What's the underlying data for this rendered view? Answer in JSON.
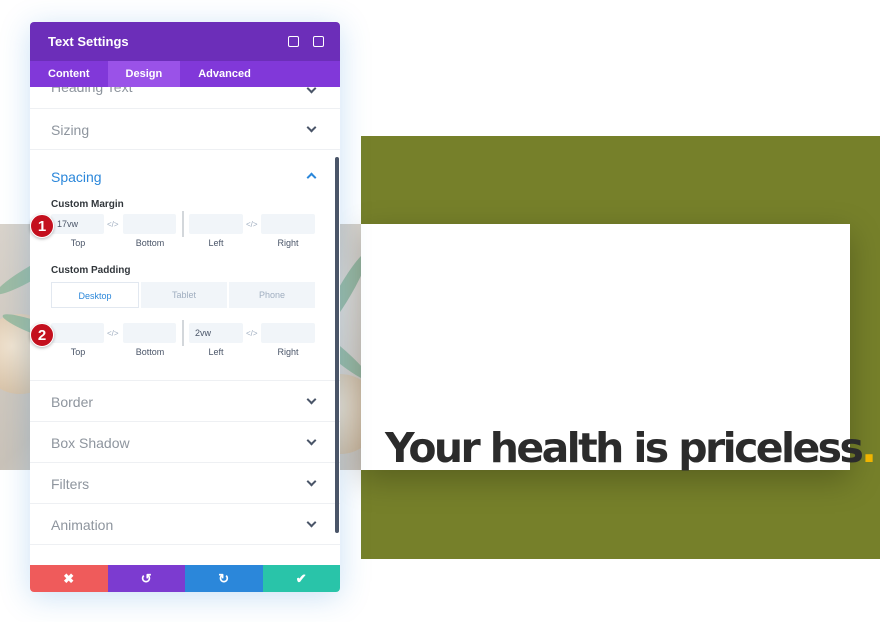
{
  "panel": {
    "title": "Text Settings",
    "tabs": [
      "Content",
      "Design",
      "Advanced"
    ],
    "active_tab": "Design"
  },
  "sections": {
    "heading_text": "Heading Text",
    "sizing": "Sizing",
    "spacing": "Spacing",
    "border": "Border",
    "box_shadow": "Box Shadow",
    "filters": "Filters",
    "animation": "Animation"
  },
  "spacing": {
    "margin_title": "Custom Margin",
    "margin": {
      "top": "17vw",
      "bottom": "",
      "left": "",
      "right": ""
    },
    "padding_title": "Custom Padding",
    "devices": [
      "Desktop",
      "Tablet",
      "Phone"
    ],
    "active_device": "Desktop",
    "padding": {
      "top": "",
      "bottom": "",
      "left": "2vw",
      "right": ""
    },
    "labels": {
      "top": "Top",
      "bottom": "Bottom",
      "left": "Left",
      "right": "Right"
    }
  },
  "badges": [
    "1",
    "2"
  ],
  "footer": {
    "cancel": "✖",
    "undo": "↺",
    "redo": "↻",
    "save": "✔",
    "colors": [
      "#ef5b5b",
      "#7c3bd0",
      "#2b87da",
      "#29c4a9"
    ]
  },
  "preview": {
    "headline": "Your health is priceless",
    "dot": ".",
    "olive_color": "#76802a",
    "accent": "#f0b400"
  },
  "icons": {
    "link": "link-icon",
    "chevron": "chevron-icon",
    "fullscreen": "fullscreen-icon",
    "sidebar": "sidebar-icon"
  }
}
